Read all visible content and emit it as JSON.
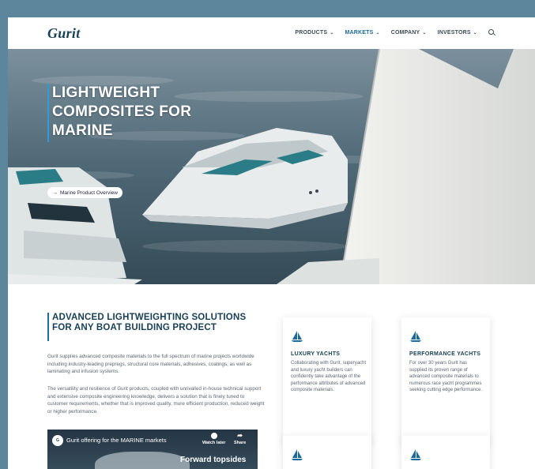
{
  "header": {
    "logo": "Gurit",
    "nav": [
      {
        "label": "PRODUCTS",
        "active": false
      },
      {
        "label": "MARKETS",
        "active": true
      },
      {
        "label": "COMPANY",
        "active": false
      },
      {
        "label": "INVESTORS",
        "active": false
      }
    ],
    "search_icon": "search-icon"
  },
  "hero": {
    "title": "LIGHTWEIGHT COMPOSITES FOR MARINE",
    "button_label": "Marine Product Overview",
    "accent": "#2d9cdb"
  },
  "intro": {
    "title": "ADVANCED LIGHTWEIGHTING SOLUTIONS FOR ANY BOAT BUILDING PROJECT",
    "p1": "Gurit supplies advanced composite materials to the full spectrum of marine projects worldwide including industry-leading prepregs, structural core materials, adhesives, coatings, as well as laminating and infusion systems.",
    "p2": "The versatility and resilience of Gurit products, coupled with unrivalled in-house technical support and extensive composite engineering knowledge, delivers a solution that is finely tuned to customer requirements, whether that is improved quality, more efficient production, reduced weight or higher performance."
  },
  "video": {
    "title": "Gurit offering for the MARINE markets",
    "watch_later": "Watch later",
    "share": "Share",
    "caption": "Forward topsides"
  },
  "cards": [
    {
      "title": "LUXURY YACHTS",
      "text": "Collaborating with Gurit, superyacht and luxury yacht builders can confidently take advantage of the performance attributes of advanced composite materials."
    },
    {
      "title": "PERFORMANCE YACHTS",
      "text": "For over 30 years Gurit has supplied its proven range of advanced composite materials to numerous race yacht programmes seeking cutting edge performance."
    },
    {
      "title": "",
      "text": ""
    },
    {
      "title": "",
      "text": ""
    }
  ],
  "colors": {
    "brand": "#173f55",
    "accent": "#1c6a9a",
    "frame": "#5b869b"
  }
}
